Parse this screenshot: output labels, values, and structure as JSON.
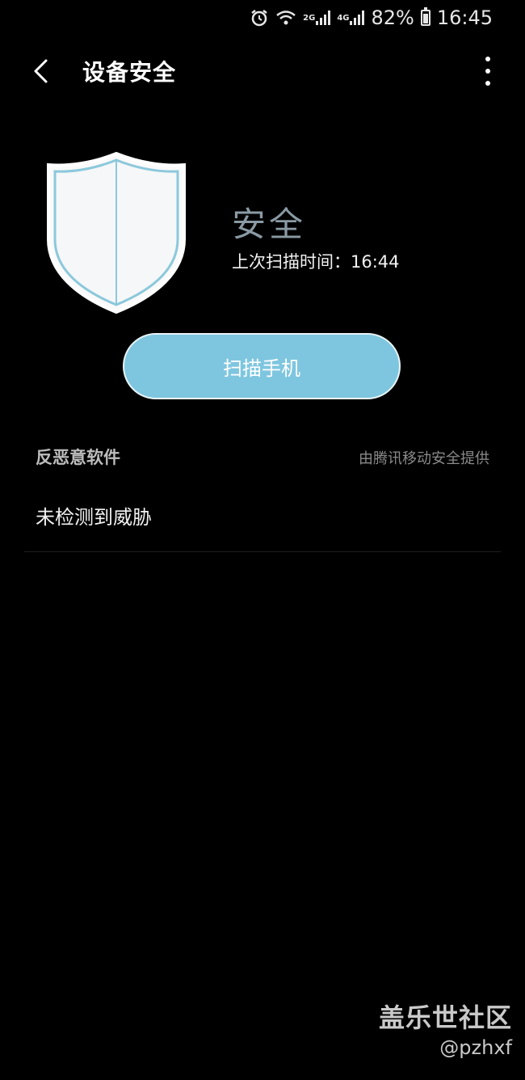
{
  "status_bar": {
    "network_2g": "2G",
    "network_4g": "4G",
    "battery_text": "82%",
    "time": "16:45",
    "icons": [
      "alarm-icon",
      "wifi-icon",
      "signal-icon",
      "battery-icon"
    ]
  },
  "header": {
    "title": "设备安全",
    "back_icon": "back-arrow-icon",
    "more_icon": "more-options-icon"
  },
  "status": {
    "shield_icon": "shield-icon",
    "title": "安全",
    "last_scan": "上次扫描时间：16:44"
  },
  "scan_button": {
    "label": "扫描手机",
    "color": "#7ec6df"
  },
  "section": {
    "header": "反恶意软件",
    "provider": "由腾讯移动安全提供",
    "items": [
      {
        "label": "未检测到威胁"
      }
    ]
  },
  "watermark": {
    "title": "盖乐世社区",
    "user": "@pzhxf"
  }
}
